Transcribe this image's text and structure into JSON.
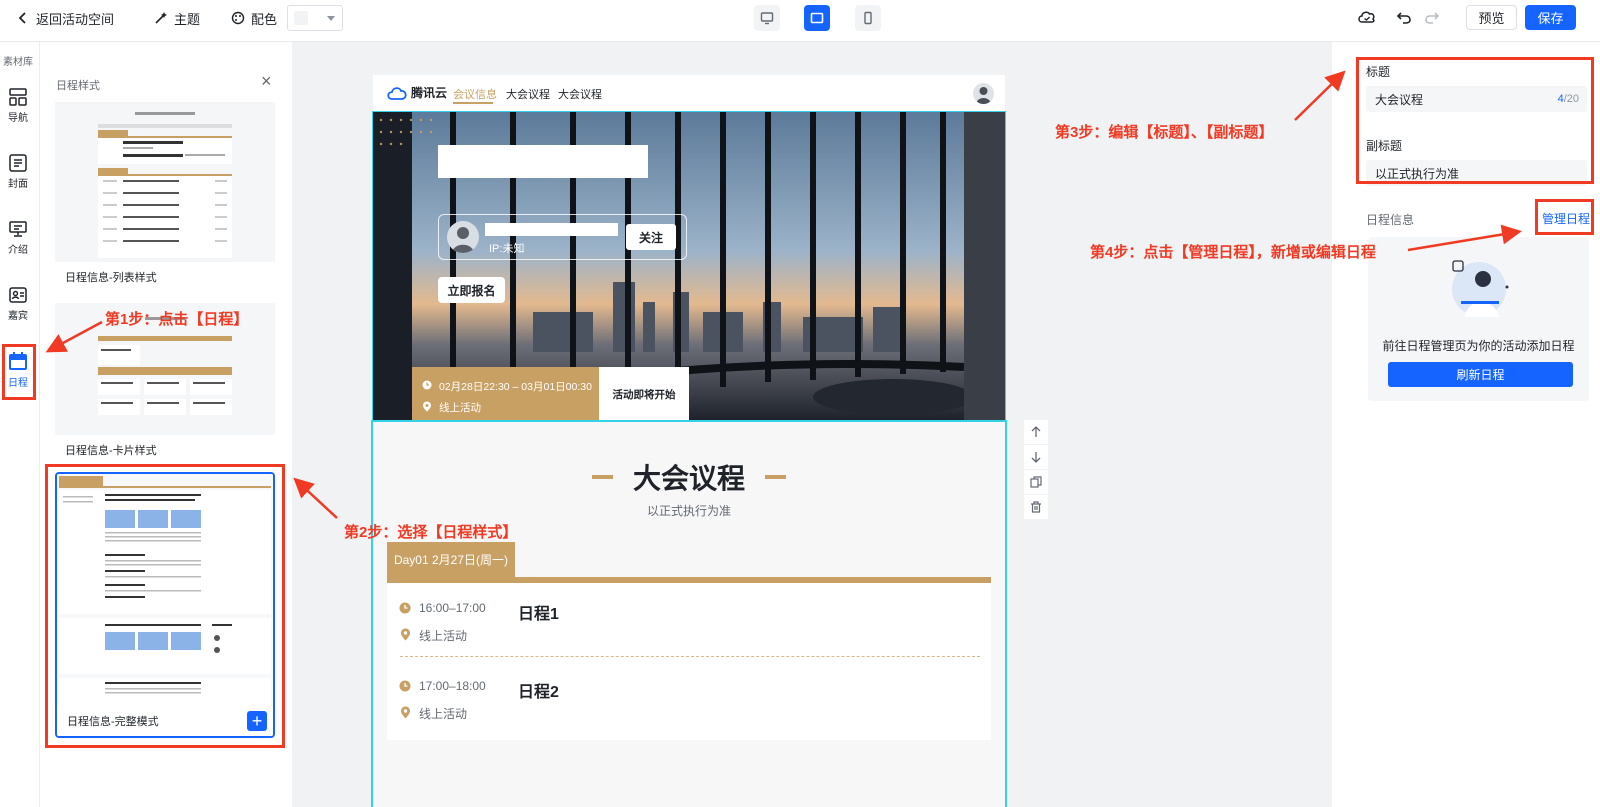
{
  "topbar": {
    "back_label": "返回活动空间",
    "theme_label": "主题",
    "color_label": "配色",
    "color_value": "#f2f3f5",
    "preview_label": "预览",
    "save_label": "保存",
    "accent": "#1664ff"
  },
  "left_rail": {
    "title": "素材库",
    "items": [
      {
        "label": "导航",
        "icon": "grid-icon"
      },
      {
        "label": "封面",
        "icon": "list-icon"
      },
      {
        "label": "介绍",
        "icon": "presentation-icon"
      },
      {
        "label": "嘉宾",
        "icon": "id-card-icon"
      },
      {
        "label": "日程",
        "icon": "calendar-icon",
        "active": true
      }
    ]
  },
  "style_panel": {
    "title": "日程样式",
    "cards": [
      {
        "label": "日程信息-列表样式"
      },
      {
        "label": "日程信息-卡片样式"
      },
      {
        "label": "日程信息-完整模式",
        "selected": true
      }
    ]
  },
  "preview": {
    "nav": {
      "logo": "腾讯云",
      "items": [
        "会议信息",
        "大会议程",
        "大会议程"
      ],
      "active_index": 0
    },
    "hero": {
      "ip_label": "IP:未知",
      "follow_label": "关注",
      "signup_label": "立即报名",
      "time_range": "02月28日22:30 – 03月01日00:30",
      "location": "线上活动",
      "status": "活动即将开始"
    },
    "agenda": {
      "title": "大会议程",
      "subtitle": "以正式执行为准",
      "day_tab": "Day01 2月27日(周一)",
      "items": [
        {
          "time": "16:00–17:00",
          "location": "线上活动",
          "name": "日程1"
        },
        {
          "time": "17:00–18:00",
          "location": "线上活动",
          "name": "日程2"
        }
      ]
    },
    "gold": "#c8a063"
  },
  "settings": {
    "title_label": "标题",
    "title_value": "大会议程",
    "title_count": "4",
    "title_max": "/20",
    "subtitle_label": "副标题",
    "subtitle_value": "以正式执行为准",
    "schedule_info_label": "日程信息",
    "manage_link": "管理日程",
    "empty_text": "前往日程管理页为你的活动添加日程",
    "refresh_label": "刷新日程"
  },
  "annotations": {
    "step1": "第1步：点击【日程】",
    "step2": "第2步：选择【日程样式】",
    "step3": "第3步：编辑【标题】、【副标题】",
    "step4": "第4步：点击【管理日程】，新增或编辑日程",
    "color": "#f03a24"
  }
}
